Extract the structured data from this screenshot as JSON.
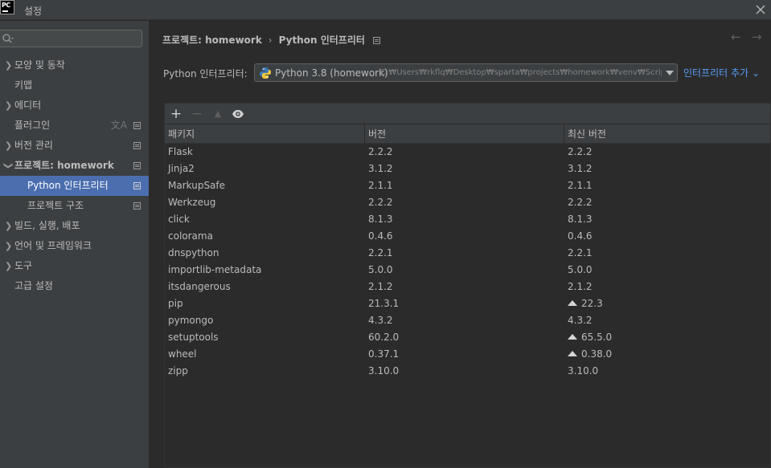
{
  "window": {
    "logo_text": "PC",
    "title": "설정",
    "icons": {
      "close": "close-icon"
    }
  },
  "sidebar": {
    "search_placeholder": "",
    "items": [
      {
        "label": "모양 및 동작",
        "expandable": true
      },
      {
        "label": "키맵",
        "expandable": false
      },
      {
        "label": "에디터",
        "expandable": true
      },
      {
        "label": "플러그인",
        "expandable": false
      },
      {
        "label": "버전 관리",
        "expandable": true
      },
      {
        "label": "프로젝트: homework",
        "expandable": true,
        "expanded": true
      },
      {
        "label": "Python 인터프리터",
        "expandable": false,
        "selected": true
      },
      {
        "label": "프로젝트 구조",
        "expandable": false
      },
      {
        "label": "빌드, 실행, 배포",
        "expandable": true
      },
      {
        "label": "언어 및 프레임워크",
        "expandable": true
      },
      {
        "label": "도구",
        "expandable": true
      },
      {
        "label": "고급 설정",
        "expandable": false
      }
    ]
  },
  "breadcrumb": {
    "parent": "프로젝트: homework",
    "current": "Python 인터프리터"
  },
  "interpreter": {
    "label": "Python 인터프리터:",
    "selected": "Python 3.8 (homework)",
    "path": "C:₩Users₩rkflq₩Desktop₩sparta₩projects₩homework₩venv₩Scripts",
    "add_label": "인터프리터 추가"
  },
  "packages": {
    "columns": [
      "패키지",
      "버전",
      "최신 버전"
    ],
    "toolbar": [
      "plus-icon",
      "minus-icon",
      "upgrade-icon",
      "eye-icon"
    ],
    "rows": [
      {
        "name": "Flask",
        "version": "2.2.2",
        "latest": "2.2.2",
        "upgrade": false
      },
      {
        "name": "Jinja2",
        "version": "3.1.2",
        "latest": "3.1.2",
        "upgrade": false
      },
      {
        "name": "MarkupSafe",
        "version": "2.1.1",
        "latest": "2.1.1",
        "upgrade": false
      },
      {
        "name": "Werkzeug",
        "version": "2.2.2",
        "latest": "2.2.2",
        "upgrade": false
      },
      {
        "name": "click",
        "version": "8.1.3",
        "latest": "8.1.3",
        "upgrade": false
      },
      {
        "name": "colorama",
        "version": "0.4.6",
        "latest": "0.4.6",
        "upgrade": false
      },
      {
        "name": "dnspython",
        "version": "2.2.1",
        "latest": "2.2.1",
        "upgrade": false
      },
      {
        "name": "importlib-metadata",
        "version": "5.0.0",
        "latest": "5.0.0",
        "upgrade": false
      },
      {
        "name": "itsdangerous",
        "version": "2.1.2",
        "latest": "2.1.2",
        "upgrade": false
      },
      {
        "name": "pip",
        "version": "21.3.1",
        "latest": "22.3",
        "upgrade": true
      },
      {
        "name": "pymongo",
        "version": "4.3.2",
        "latest": "4.3.2",
        "upgrade": false
      },
      {
        "name": "setuptools",
        "version": "60.2.0",
        "latest": "65.5.0",
        "upgrade": true
      },
      {
        "name": "wheel",
        "version": "0.37.1",
        "latest": "0.38.0",
        "upgrade": true
      },
      {
        "name": "zipp",
        "version": "3.10.0",
        "latest": "3.10.0",
        "upgrade": false
      }
    ]
  },
  "colors": {
    "background": "#2b2b2b",
    "panel": "#3c3f41",
    "selection": "#4b6eaf",
    "link": "#589df6",
    "text": "#bbbbbb"
  }
}
